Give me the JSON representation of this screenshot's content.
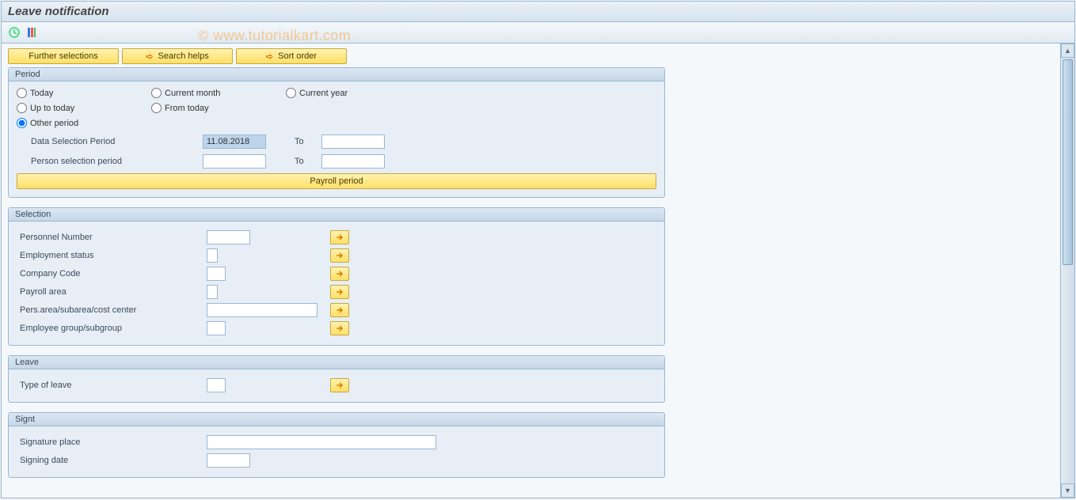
{
  "title": "Leave notification",
  "watermark": "© www.tutorialkart.com",
  "buttons": {
    "further_selections": "Further selections",
    "search_helps": "Search helps",
    "sort_order": "Sort order",
    "payroll_period": "Payroll period"
  },
  "period": {
    "title": "Period",
    "today": "Today",
    "current_month": "Current month",
    "current_year": "Current year",
    "up_to_today": "Up to today",
    "from_today": "From today",
    "other_period": "Other period",
    "data_selection_period": "Data Selection Period",
    "data_selection_value": "11.08.2018",
    "to": "To",
    "person_selection_period": "Person selection period"
  },
  "selection": {
    "title": "Selection",
    "personnel_number": "Personnel Number",
    "employment_status": "Employment status",
    "company_code": "Company Code",
    "payroll_area": "Payroll area",
    "pers_area": "Pers.area/subarea/cost center",
    "employee_group": "Employee group/subgroup"
  },
  "leave": {
    "title": "Leave",
    "type_of_leave": "Type of leave"
  },
  "signt": {
    "title": "Signt",
    "signature_place": "Signature place",
    "signing_date": "Signing date"
  }
}
